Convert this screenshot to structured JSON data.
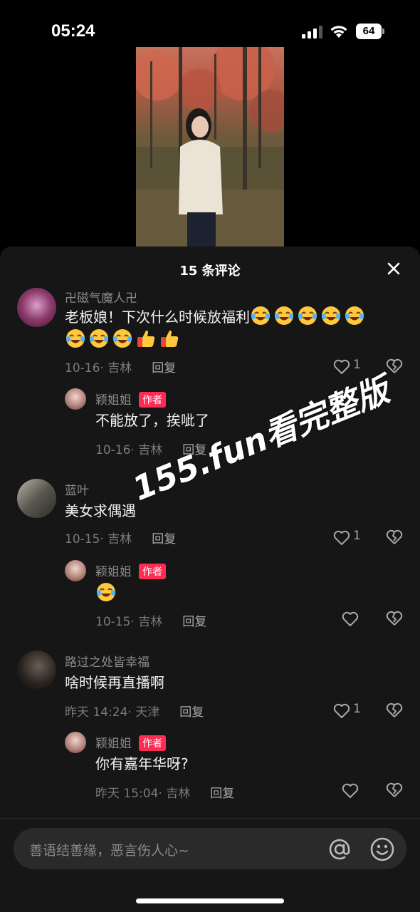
{
  "status_bar": {
    "time": "05:24",
    "battery": "64"
  },
  "sheet": {
    "title": "15 条评论"
  },
  "comments": [
    {
      "username": "卍磁气魔人卍",
      "text_line1": "老板娘！下次什么时候放福利",
      "date": "10-16",
      "location": "吉林",
      "reply_label": "回复",
      "likes": "1"
    },
    {
      "username": "颖姐姐",
      "badge": "作者",
      "text": "不能放了，挨呲了",
      "date": "10-16",
      "location": "吉林",
      "reply_label": "回复"
    },
    {
      "username": "蓝叶",
      "text": "美女求偶遇",
      "date": "10-15",
      "location": "吉林",
      "reply_label": "回复",
      "likes": "1"
    },
    {
      "username": "颖姐姐",
      "badge": "作者",
      "date": "10-15",
      "location": "吉林",
      "reply_label": "回复"
    },
    {
      "username": "路过之处皆幸福",
      "text": "啥时候再直播啊",
      "date": "昨天 14:24",
      "location": "天津",
      "reply_label": "回复",
      "likes": "1"
    },
    {
      "username": "颖姐姐",
      "badge": "作者",
      "text": "你有嘉年华呀?",
      "date": "昨天 15:04",
      "location": "吉林",
      "reply_label": "回复"
    }
  ],
  "watermark": "155.fun看完整版",
  "input": {
    "placeholder": "善语结善缘，恶言伤人心~"
  }
}
